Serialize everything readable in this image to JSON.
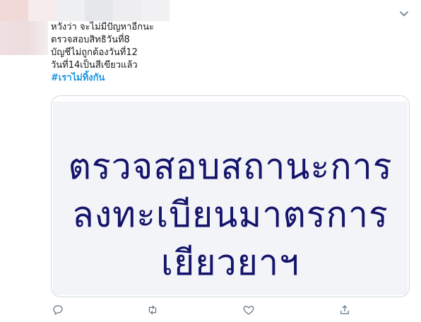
{
  "header": {
    "blurred_colors": [
      "#f0d9d6",
      "#f6ecec",
      "#eff0f2",
      "#e6e7ea",
      "#eeeef0",
      "#f1f1f3"
    ],
    "menu_icon": "chevron-down-icon"
  },
  "tweet": {
    "lines": [
      "หวังว่า จะไม่มีปัญหาอีกนะ",
      "ตรวจสอบสิทธิวันที่8",
      "บัญชีไม่ถูกต้องวันที่12",
      "วันที่14เป็นสีเขียวแล้ว"
    ],
    "hashtag": "#เราไม่ทิ้งกัน",
    "hashtag_color": "#1b95e0"
  },
  "media": {
    "lines": [
      "ตรวจสอบสถานะการ",
      "ลงทะเบียนมาตรการ",
      "เยียวยาฯ"
    ],
    "text_color": "#14146b",
    "background": "#f3f4f8"
  },
  "actions": {
    "reply_icon": "reply-icon",
    "retweet_icon": "retweet-icon",
    "like_icon": "heart-icon",
    "share_icon": "share-icon"
  }
}
